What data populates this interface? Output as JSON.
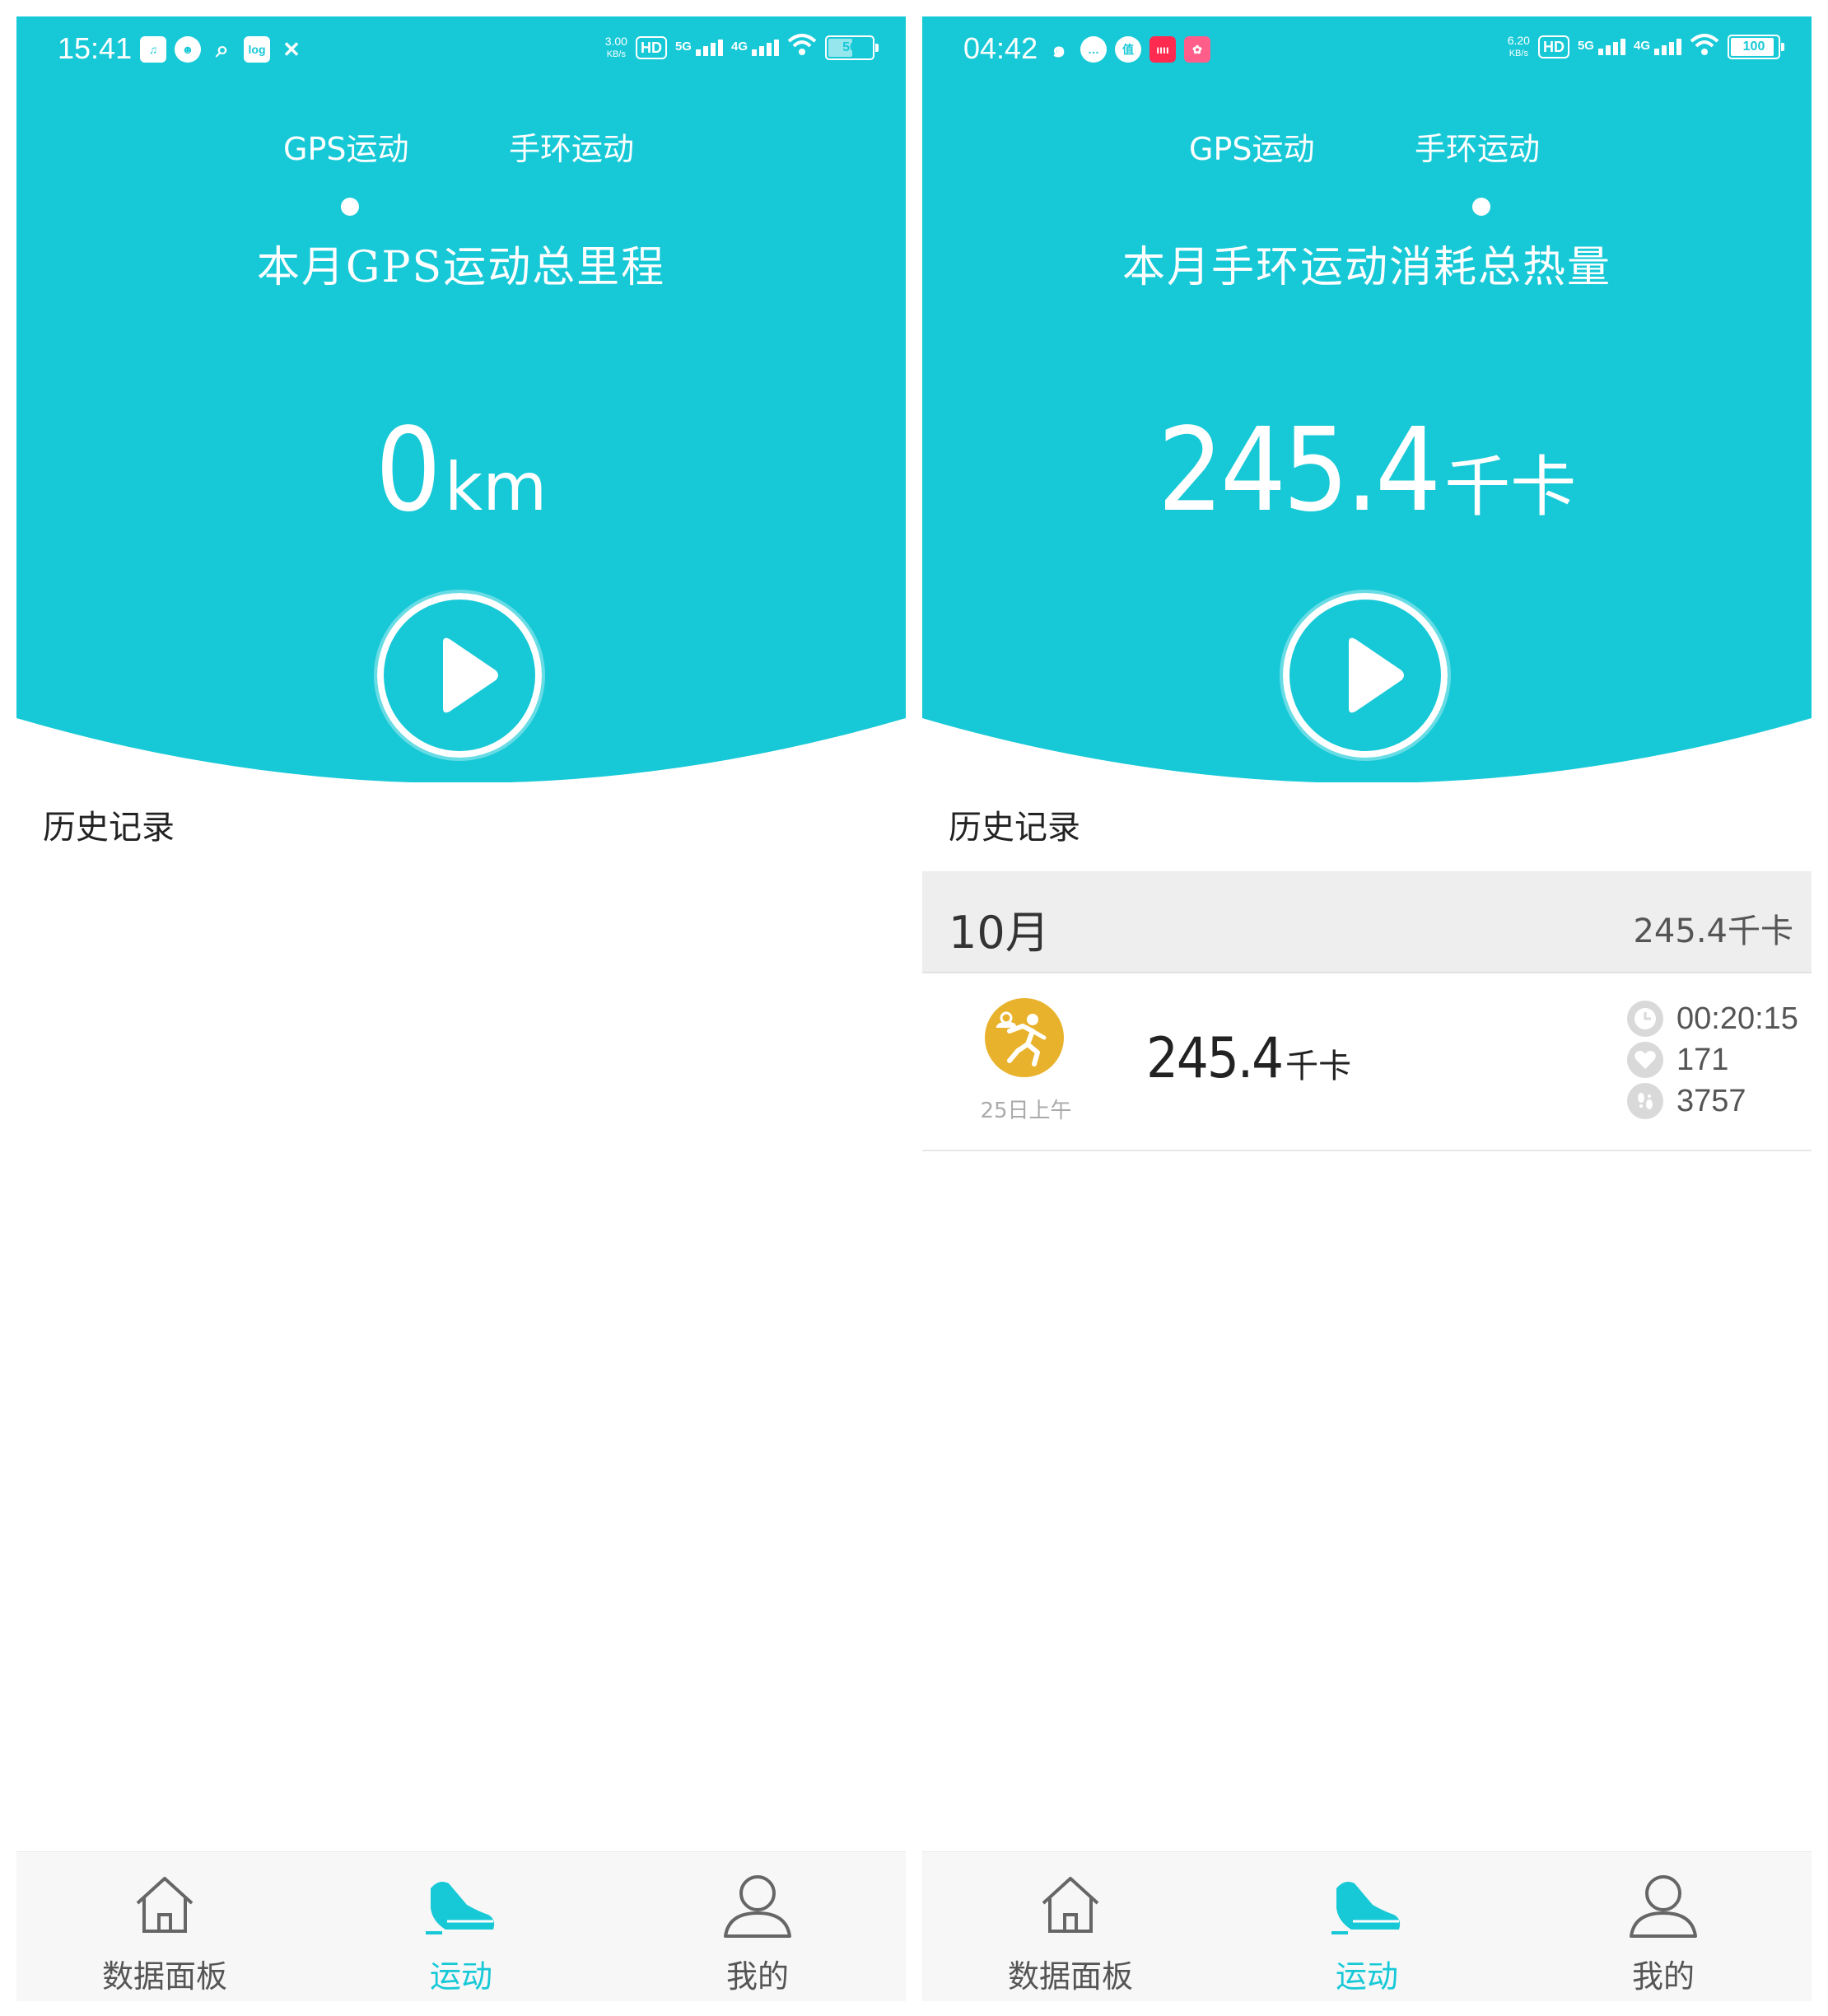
{
  "screens": [
    {
      "status": {
        "time": "15:41",
        "speed_top": "3.00",
        "speed_unit": "KB/s",
        "hd": "HD",
        "net1": "5G",
        "net2": "4G",
        "battery": "56",
        "notif_icons": [
          "music-icon",
          "qq-penguin-icon",
          "search-icon",
          "log-icon",
          "tools-icon"
        ]
      },
      "tabs": [
        "GPS运动",
        "手环运动"
      ],
      "active_tab": 0,
      "hero_title": "本月GPS运动总里程",
      "hero_value": "0",
      "hero_unit": "km",
      "section_title": "历史记录",
      "nav": [
        {
          "label": "数据面板",
          "icon": "home-icon"
        },
        {
          "label": "运动",
          "icon": "sneaker-icon"
        },
        {
          "label": "我的",
          "icon": "user-icon"
        }
      ],
      "active_nav": 1
    },
    {
      "status": {
        "time": "04:42",
        "speed_top": "6.20",
        "speed_unit": "KB/s",
        "hd": "HD",
        "net1": "5G",
        "net2": "4G",
        "battery": "100",
        "notif_icons": [
          "weibo-icon",
          "chat-icon",
          "zhi-icon",
          "app-red-icon",
          "app-pink-icon"
        ]
      },
      "tabs": [
        "GPS运动",
        "手环运动"
      ],
      "active_tab": 1,
      "hero_title": "本月手环运动消耗总热量",
      "hero_value": "245.4",
      "hero_unit": "千卡",
      "section_title": "历史记录",
      "month": {
        "label": "10月",
        "total": "245.4千卡"
      },
      "records": [
        {
          "date": "25日上午",
          "kcal": "245.4",
          "kcal_unit": "千卡",
          "duration": "00:20:15",
          "heart_rate": "171",
          "steps": "3757",
          "icon": "running-icon"
        }
      ],
      "nav": [
        {
          "label": "数据面板",
          "icon": "home-icon"
        },
        {
          "label": "运动",
          "icon": "sneaker-icon"
        },
        {
          "label": "我的",
          "icon": "user-icon"
        }
      ],
      "active_nav": 1
    }
  ],
  "colors": {
    "primary": "#17c9d7",
    "record_icon": "#e9b22c",
    "month_bg": "#eeeeee"
  }
}
